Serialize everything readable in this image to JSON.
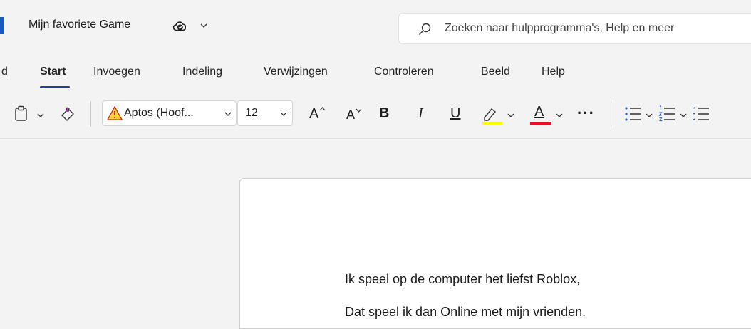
{
  "title_bar": {
    "document_title": "Mijn favoriete Game",
    "save_status_icon": "cloud-sync-icon",
    "search_placeholder": "Zoeken naar hulpprogramma's, Help en meer"
  },
  "ribbon": {
    "partial_tab": "d",
    "tabs": [
      "Start",
      "Invoegen",
      "Indeling",
      "Verwijzingen",
      "Controleren",
      "Beeld",
      "Help"
    ],
    "active_tab": "Start"
  },
  "toolbar": {
    "font_name": "Aptos (Hoof...",
    "font_size": "12",
    "grow_font": "A",
    "shrink_font": "A",
    "bold": "B",
    "italic": "I",
    "underline": "U",
    "font_color_letter": "A",
    "more": "···",
    "highlight_color": "#ffff00",
    "font_color": "#e81123"
  },
  "document": {
    "paragraphs": [
      "Ik speel op de computer het liefst Roblox,",
      "Dat speel ik dan Online met mijn vrienden."
    ]
  }
}
